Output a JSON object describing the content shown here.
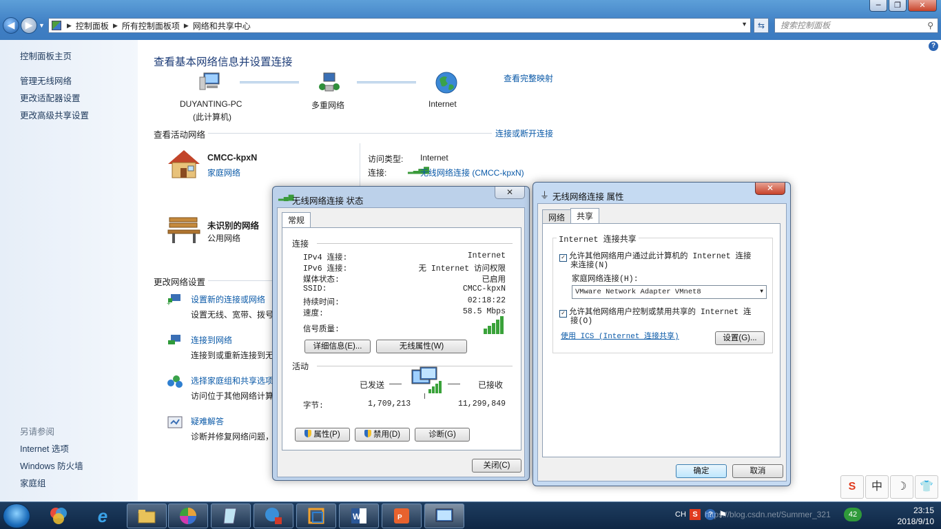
{
  "window": {
    "min": "─",
    "max": "❐",
    "close": "✕"
  },
  "address": {
    "crumbs": [
      "控制面板",
      "所有控制面板项",
      "网络和共享中心"
    ],
    "search_placeholder": "搜索控制面板"
  },
  "leftnav": {
    "home": "控制面板主页",
    "items": [
      "管理无线网络",
      "更改适配器设置",
      "更改高级共享设置"
    ],
    "see_also": "另请参阅",
    "see_also_items": [
      "Internet 选项",
      "Windows 防火墙",
      "家庭组"
    ]
  },
  "main": {
    "title": "查看基本网络信息并设置连接",
    "see_full_map": "查看完整映射",
    "map": {
      "pc_name": "DUYANTING-PC",
      "pc_sub": "(此计算机)",
      "multi": "多重网络",
      "internet": "Internet"
    },
    "active_title": "查看活动网络",
    "connect_disconnect": "连接或断开连接",
    "net1": {
      "name": "CMCC-kpxN",
      "type": "家庭网络",
      "access_label": "访问类型:",
      "access_value": "Internet",
      "conn_label": "连接:",
      "conn_value": "无线网络连接 (CMCC-kpxN)"
    },
    "net2": {
      "name": "未识别的网络",
      "type": "公用网络"
    },
    "change_title": "更改网络设置",
    "tasks": [
      {
        "title": "设置新的连接或网络",
        "desc": "设置无线、宽带、拨号"
      },
      {
        "title": "连接到网络",
        "desc": "连接到或重新连接到无"
      },
      {
        "title": "选择家庭组和共享选项",
        "desc": "访问位于其他网络计算"
      },
      {
        "title": "疑难解答",
        "desc": "诊断并修复网络问题，"
      }
    ]
  },
  "status_dialog": {
    "title": "无线网络连接 状态",
    "tab": "常规",
    "conn_group": "连接",
    "rows": [
      {
        "k": "IPv4 连接:",
        "v": "Internet"
      },
      {
        "k": "IPv6 连接:",
        "v": "无 Internet 访问权限"
      },
      {
        "k": "媒体状态:",
        "v": "已启用"
      },
      {
        "k": "SSID:",
        "v": "CMCC-kpxN"
      },
      {
        "k": "持续时间:",
        "v": "02:18:22"
      },
      {
        "k": "速度:",
        "v": "58.5 Mbps"
      }
    ],
    "signal_label": "信号质量:",
    "details_btn": "详细信息(E)...",
    "wireless_props_btn": "无线属性(W)",
    "activity_group": "活动",
    "sent": "已发送",
    "received": "已接收",
    "bytes_label": "字节:",
    "bytes_sent": "1,709,213",
    "bytes_received": "11,299,849",
    "props_btn": "属性(P)",
    "disable_btn": "禁用(D)",
    "diagnose_btn": "诊断(G)",
    "close_btn": "关闭(C)"
  },
  "props_dialog": {
    "title": "无线网络连接 属性",
    "tabs": [
      "网络",
      "共享"
    ],
    "group": "Internet 连接共享",
    "cb1_line1": "允许其他网络用户通过此计算机的 Internet 连接",
    "cb1_line2": "来连接(N)",
    "home_conn_label": "家庭网络连接(H):",
    "home_conn_value": "VMware Network Adapter VMnet8",
    "cb2_line1": "允许其他网络用户控制或禁用共享的 Internet 连",
    "cb2_line2": "接(O)",
    "ics_link": "使用 ICS (Internet 连接共享)",
    "settings_btn": "设置(G)...",
    "ok_btn": "确定",
    "cancel_btn": "取消"
  },
  "taskbar": {
    "tray_lang": "CH",
    "tray_badge": "42",
    "time": "23:15",
    "date": "2018/9/10",
    "watermark": "https://blog.csdn.net/Summer_321"
  },
  "ime": [
    "中",
    "☽",
    "👕"
  ]
}
